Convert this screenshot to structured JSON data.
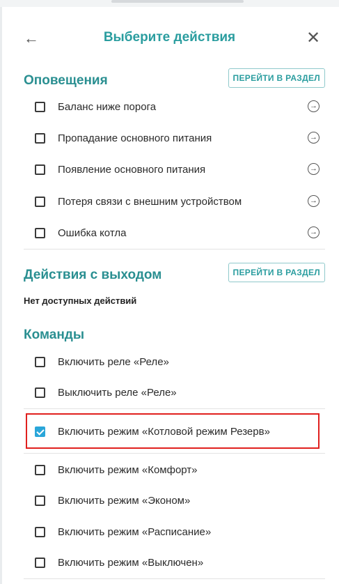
{
  "dialog": {
    "title": "Выберите действия",
    "back_icon": "←",
    "close_icon": "✕"
  },
  "sections": {
    "notifications": {
      "title": "Оповещения",
      "goto_label": "ПЕРЕЙТИ В РАЗДЕЛ",
      "items": [
        {
          "label": "Баланс ниже порога",
          "checked": false
        },
        {
          "label": "Пропадание основного питания",
          "checked": false
        },
        {
          "label": "Появление основного питания",
          "checked": false
        },
        {
          "label": "Потеря связи с внешним устройством",
          "checked": false
        },
        {
          "label": "Ошибка котла",
          "checked": false
        }
      ]
    },
    "output_actions": {
      "title": "Действия с выходом",
      "goto_label": "ПЕРЕЙТИ В РАЗДЕЛ",
      "empty_text": "Нет доступных действий"
    },
    "commands": {
      "title": "Команды",
      "items": [
        {
          "label": "Включить реле «Реле»",
          "checked": false
        },
        {
          "label": "Выключить реле «Реле»",
          "checked": false
        },
        {
          "label": "Включить режим «Котловой режим Резерв»",
          "checked": true
        },
        {
          "label": "Включить режим «Комфорт»",
          "checked": false
        },
        {
          "label": "Включить режим «Эконом»",
          "checked": false
        },
        {
          "label": "Включить режим «Расписание»",
          "checked": false
        },
        {
          "label": "Включить режим «Выключен»",
          "checked": false
        }
      ]
    }
  },
  "go_icon_glyph": "→",
  "colors": {
    "accent": "#2a9d9f",
    "checked": "#2aa6d9",
    "highlight": "#e0201e"
  }
}
